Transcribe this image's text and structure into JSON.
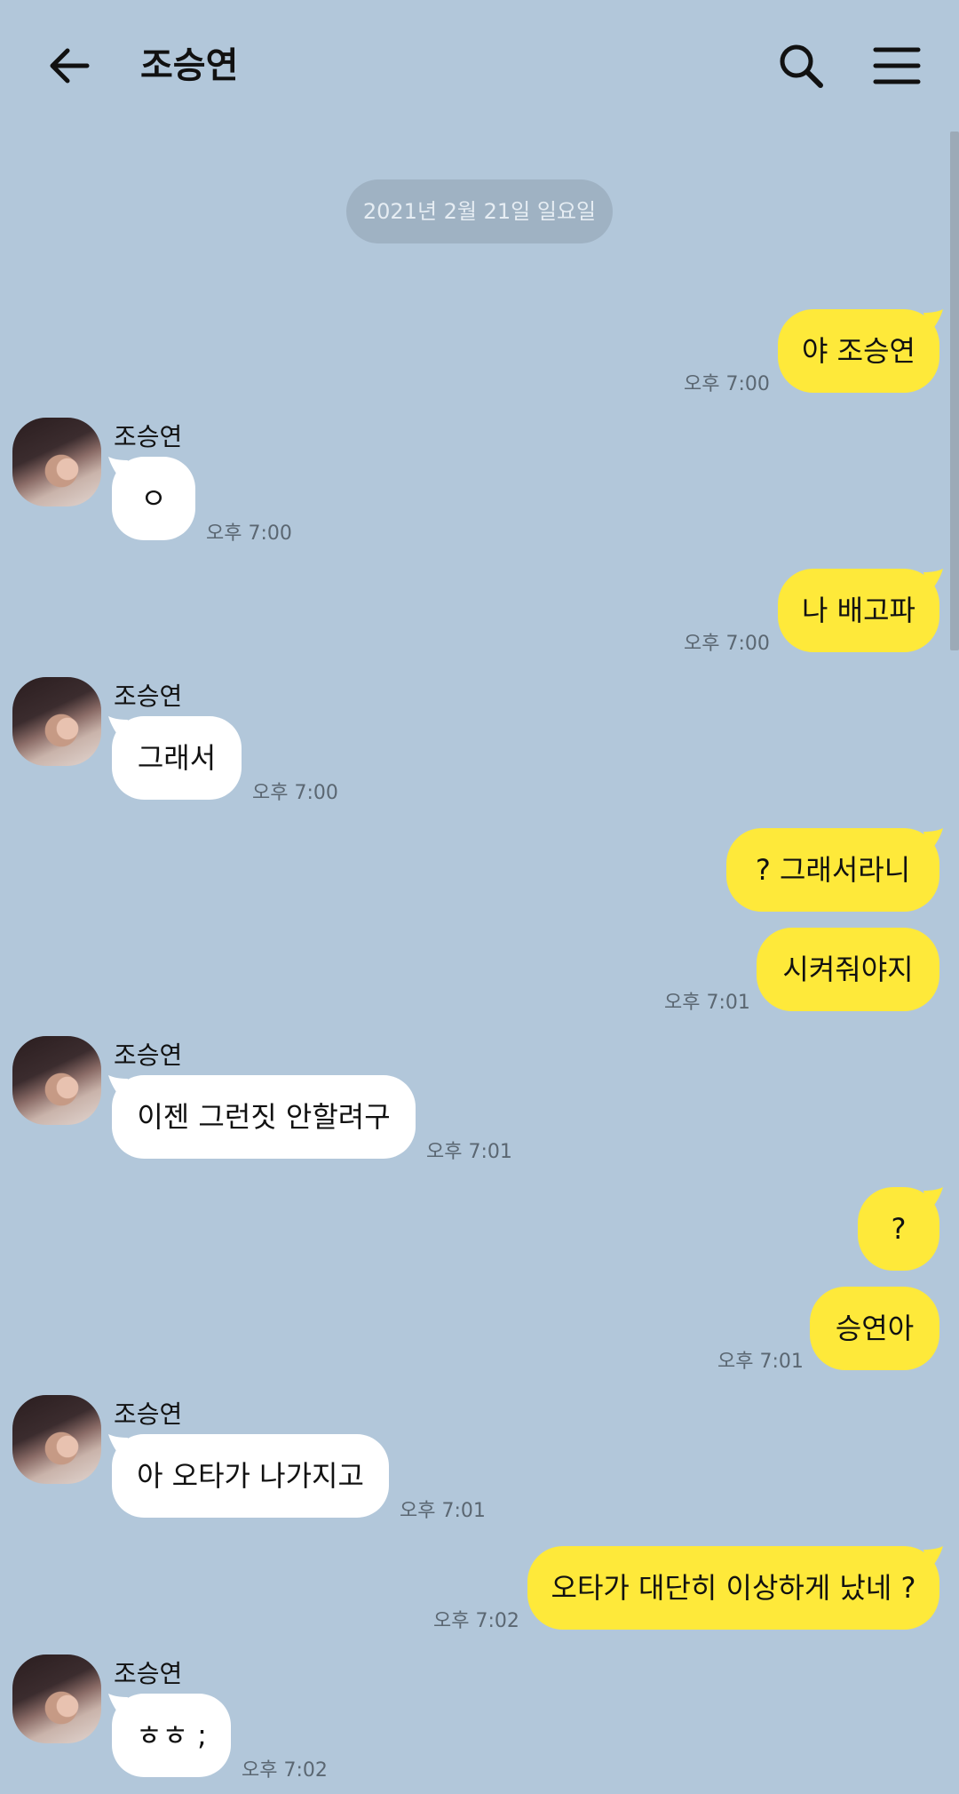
{
  "header": {
    "title": "조승연",
    "back_icon": "arrow-left-icon",
    "search_icon": "search-icon",
    "menu_icon": "hamburger-menu-icon"
  },
  "date_divider": "2021년 2월 21일 일요일",
  "sender_name": "조승연",
  "messages": [
    {
      "from": "me",
      "text": "야 조승연",
      "time": "오후 7:00"
    },
    {
      "from": "them",
      "text": "ㅇ",
      "time": "오후 7:00"
    },
    {
      "from": "me",
      "text": "나 배고파",
      "time": "오후 7:00"
    },
    {
      "from": "them",
      "text": "그래서",
      "time": "오후 7:00"
    },
    {
      "from": "me",
      "text": "? 그래서라니"
    },
    {
      "from": "me",
      "text": "시켜줘야지",
      "time": "오후 7:01"
    },
    {
      "from": "them",
      "text": "이젠 그런짓 안할려구",
      "time": "오후 7:01"
    },
    {
      "from": "me",
      "text": "?"
    },
    {
      "from": "me",
      "text": "승연아",
      "time": "오후 7:01"
    },
    {
      "from": "them",
      "text": "아 오타가 나가지고",
      "time": "오후 7:01"
    },
    {
      "from": "me",
      "text": "오타가 대단히 이상하게 났네 ?",
      "time": "오후 7:02"
    },
    {
      "from": "them",
      "text": "ㅎㅎ ;",
      "time": "오후 7:02"
    }
  ],
  "colors": {
    "background": "#b2c7da",
    "my_bubble": "#fee93a",
    "their_bubble": "#ffffff"
  }
}
